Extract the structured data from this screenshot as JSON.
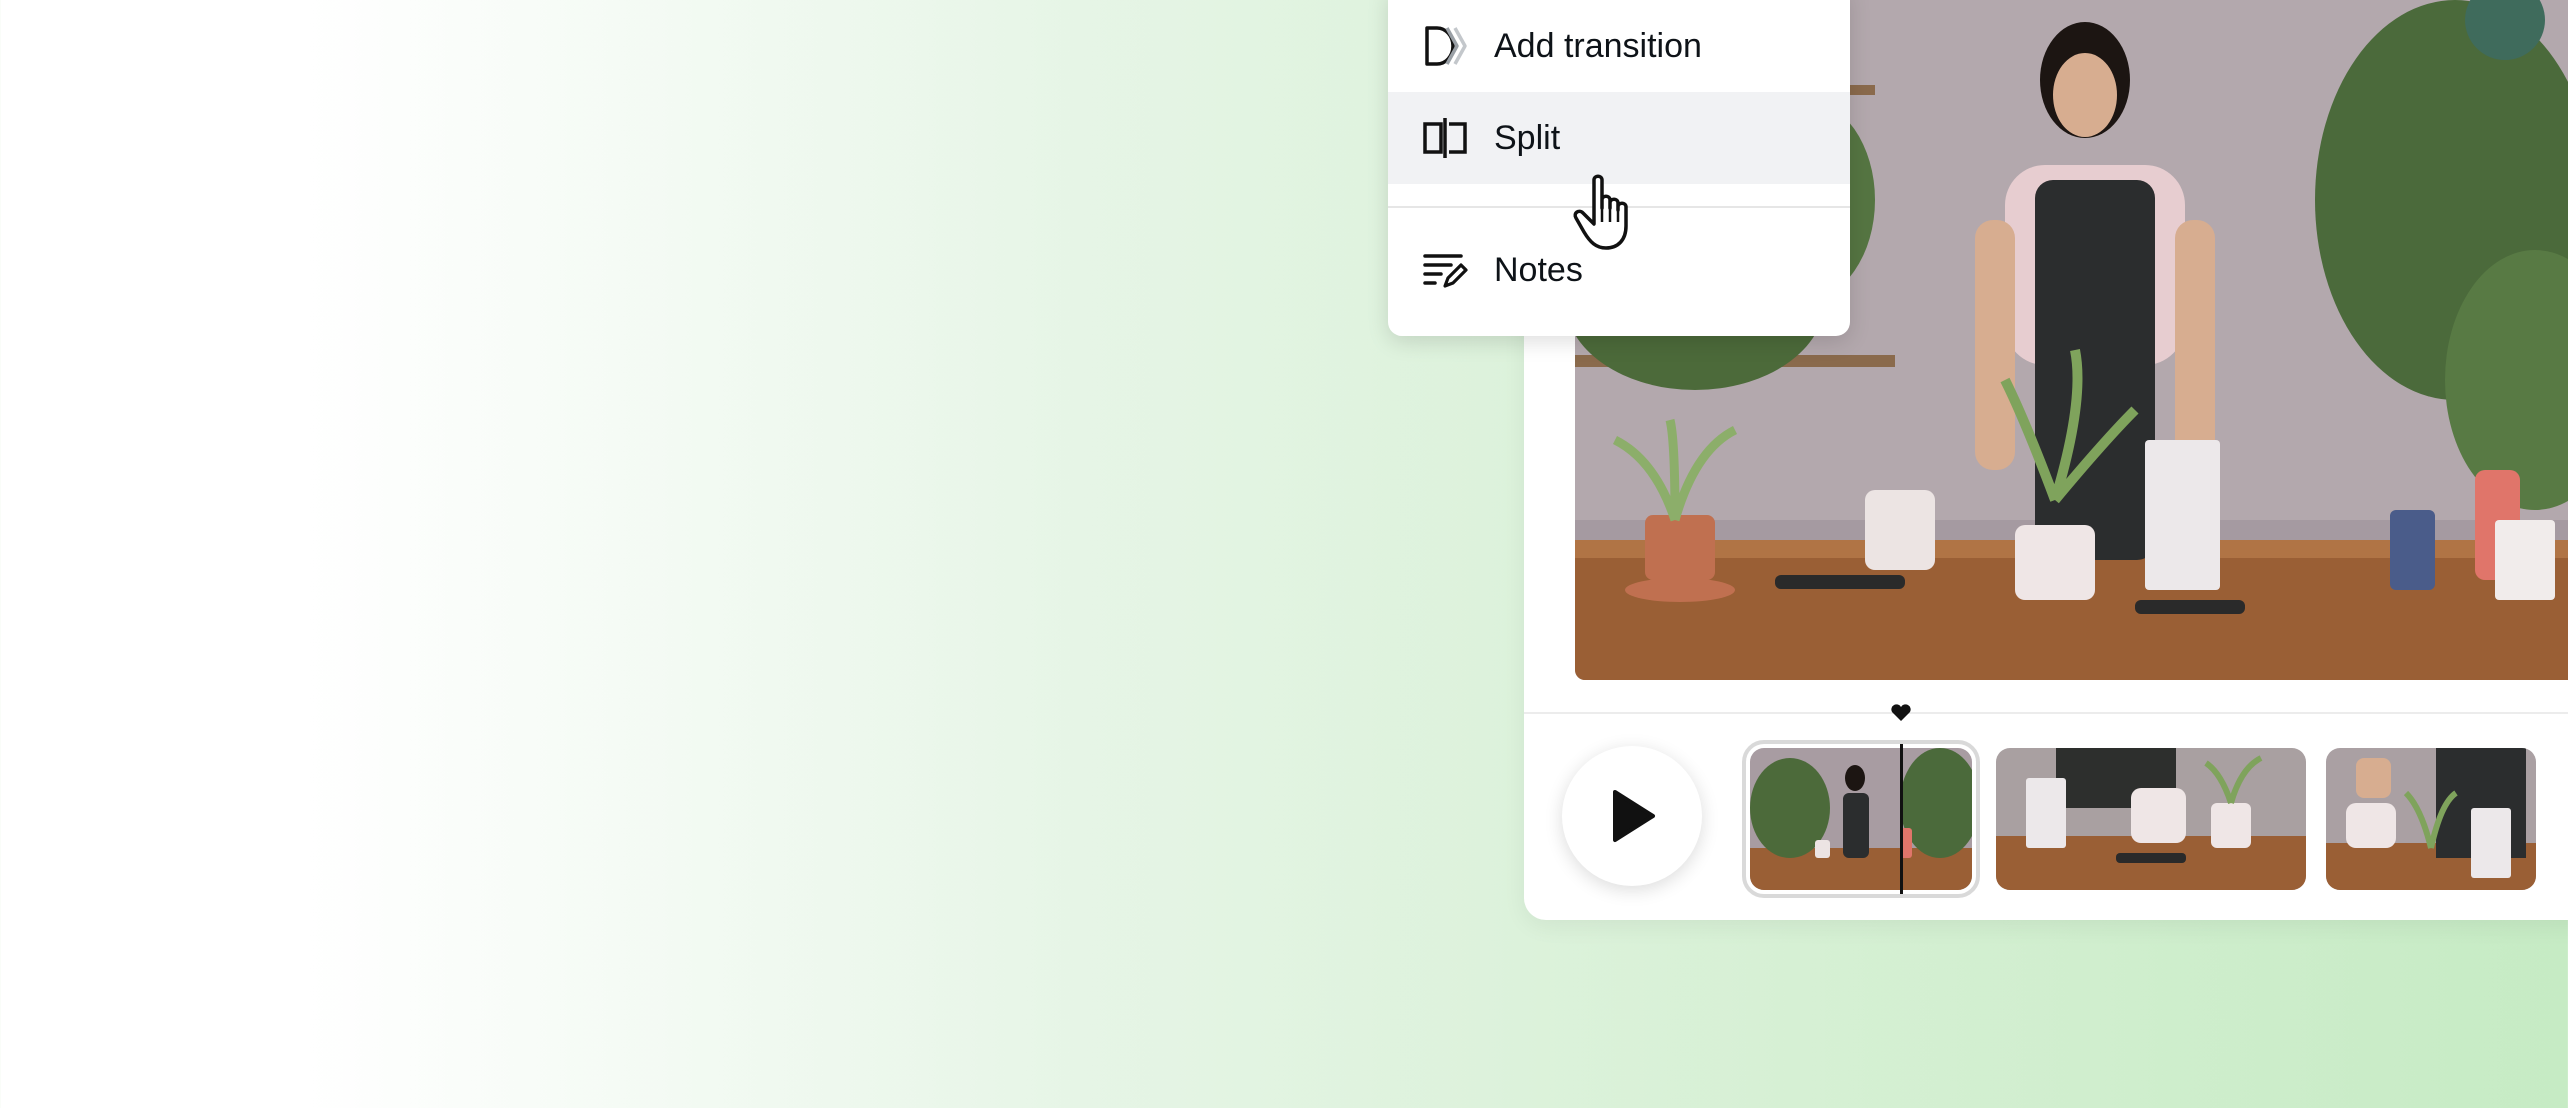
{
  "context_menu": {
    "items": [
      {
        "label": "Add transition",
        "icon": "transition-icon"
      },
      {
        "label": "Split",
        "icon": "split-icon",
        "hovered": true
      },
      {
        "label": "Notes",
        "icon": "notes-icon"
      }
    ]
  },
  "player": {
    "play_icon": "play-icon"
  },
  "timeline": {
    "clips": [
      {
        "name": "clip-1",
        "selected": true
      },
      {
        "name": "clip-2",
        "selected": false
      },
      {
        "name": "clip-3",
        "selected": false
      }
    ]
  },
  "colors": {
    "menu_hover": "#f1f2f4",
    "text": "#0e1318",
    "background_gradient_end": "#c6ebc4"
  }
}
